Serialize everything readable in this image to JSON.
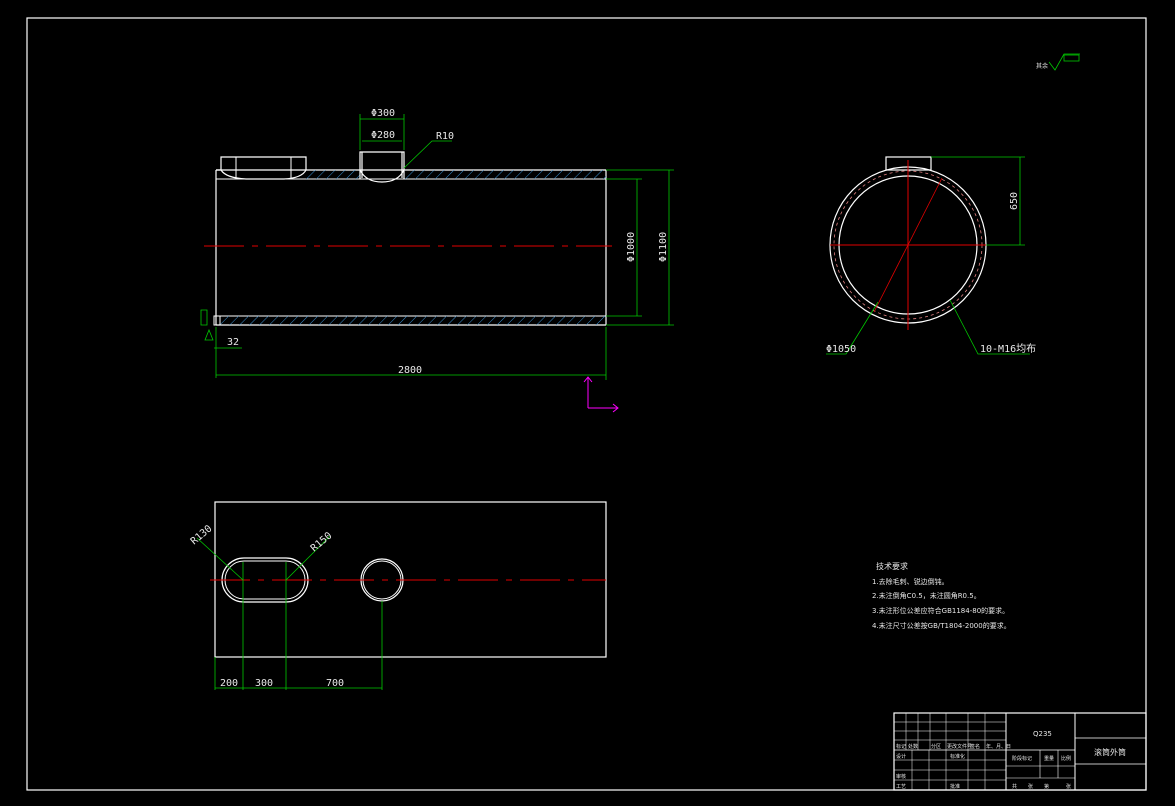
{
  "colors": {
    "background": "#000000",
    "outline": "#ffffff",
    "dimension": "#00c800",
    "centerline": "#e00000",
    "ucs_icon": "#ff00ff",
    "text": "#e8e8e8"
  },
  "drawing": {
    "main_view": {
      "dims": {
        "phi300": "Φ300",
        "phi280": "Φ280",
        "r10": "R10",
        "phi1000": "Φ1000",
        "phi1100": "Φ1100",
        "d32": "32",
        "d2800": "2800"
      }
    },
    "side_view": {
      "dims": {
        "d650": "650",
        "phi1050": "Φ1050",
        "holes": "10-M16均布"
      }
    },
    "developed_view": {
      "dims": {
        "r130": "R130",
        "r150": "R150",
        "d200": "200",
        "d300": "300",
        "d700": "700"
      }
    },
    "roughness_symbol": {
      "label": "其余"
    }
  },
  "notes": {
    "heading": "技术要求",
    "items": [
      "1.去除毛刺、锐边倒钝。",
      "2.未注倒角C0.5，未注圆角R0.5。",
      "3.未注形位公差应符合GB1184-80的要求。",
      "4.未注尺寸公差按GB/T1804-2000的要求。"
    ]
  },
  "title_block": {
    "material": "Q235",
    "part_name": "滚筒外筒",
    "row_labels": [
      "标记",
      "处数",
      "分区",
      "更改文件号",
      "签名",
      "年、月、日"
    ],
    "design": "设计",
    "standardize": "标准化",
    "stage_mark": "阶段标记",
    "weight": "重量",
    "scale": "比例",
    "review": "审核",
    "process": "工艺",
    "approve": "批准",
    "sheet_info": [
      "共",
      "张",
      "第",
      "张"
    ]
  }
}
